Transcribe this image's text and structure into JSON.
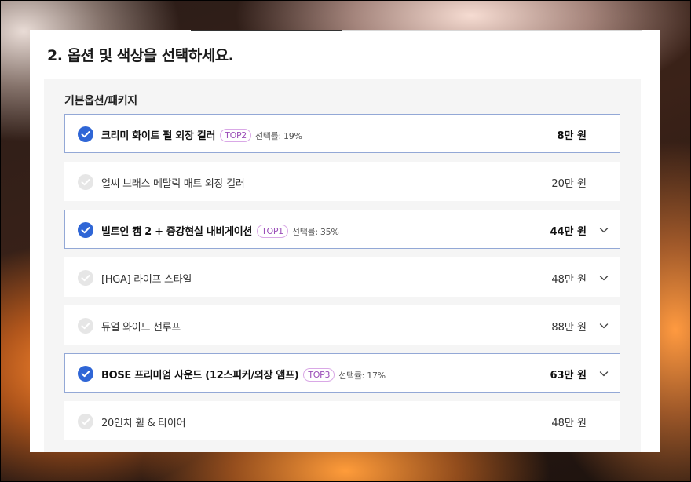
{
  "section": {
    "title": "2. 옵션 및 색상을 선택하세요."
  },
  "group": {
    "label": "기본옵션/패키지"
  },
  "colors": {
    "check_selected": "#2f66d6",
    "check_unselected": "#e6e6e6",
    "badge": "#9b4fb8",
    "selected_border": "#93a8d6"
  },
  "options": [
    {
      "name": "크리미 화이트 펄 외장 컬러",
      "selected": true,
      "badge": "TOP2",
      "rate": "선택률: 19%",
      "price": "8만 원",
      "expandable": false
    },
    {
      "name": "얼씨 브래스 메탈릭 매트 외장 컬러",
      "selected": false,
      "badge": "",
      "rate": "",
      "price": "20만 원",
      "expandable": false
    },
    {
      "name": "빌트인 캠 2 + 증강현실 내비게이션",
      "selected": true,
      "badge": "TOP1",
      "rate": "선택률: 35%",
      "price": "44만 원",
      "expandable": true
    },
    {
      "name": "[HGA] 라이프 스타일",
      "selected": false,
      "badge": "",
      "rate": "",
      "price": "48만 원",
      "expandable": true
    },
    {
      "name": "듀얼 와이드 선루프",
      "selected": false,
      "badge": "",
      "rate": "",
      "price": "88만 원",
      "expandable": true
    },
    {
      "name": "BOSE 프리미엄 사운드 (12스피커/외장 앰프)",
      "selected": true,
      "badge": "TOP3",
      "rate": "선택률: 17%",
      "price": "63만 원",
      "expandable": true
    },
    {
      "name": "20인치 휠 & 타이어",
      "selected": false,
      "badge": "",
      "rate": "",
      "price": "48만 원",
      "expandable": false
    }
  ]
}
